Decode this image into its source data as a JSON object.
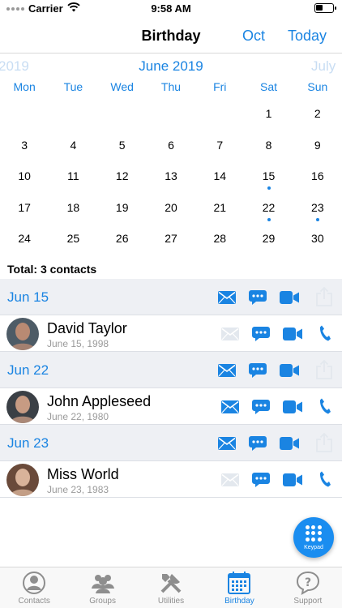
{
  "status": {
    "carrier": "Carrier",
    "time": "9:58 AM"
  },
  "nav": {
    "title": "Birthday",
    "oct": "Oct",
    "today": "Today"
  },
  "calendar": {
    "prev_month": "2019",
    "month": "June 2019",
    "next_month": "July",
    "weekdays": [
      "Mon",
      "Tue",
      "Wed",
      "Thu",
      "Fri",
      "Sat",
      "Sun"
    ],
    "weeks": [
      [
        "",
        "",
        "",
        "",
        "",
        "1",
        "2"
      ],
      [
        "3",
        "4",
        "5",
        "6",
        "7",
        "8",
        "9"
      ],
      [
        "10",
        "11",
        "12",
        "13",
        "14",
        "15",
        "16"
      ],
      [
        "17",
        "18",
        "19",
        "20",
        "21",
        "22",
        "23"
      ],
      [
        "24",
        "25",
        "26",
        "27",
        "28",
        "29",
        "30"
      ]
    ],
    "birthday_days": [
      "15",
      "22",
      "23"
    ]
  },
  "total": "Total: 3 contacts",
  "groups": [
    {
      "date": "Jun 15",
      "contact": {
        "name": "David Taylor",
        "birthday": "June 15, 1998",
        "email_enabled": false
      }
    },
    {
      "date": "Jun 22",
      "contact": {
        "name": "John Appleseed",
        "birthday": "June 22, 1980",
        "email_enabled": true
      }
    },
    {
      "date": "Jun 23",
      "contact": {
        "name": "Miss World",
        "birthday": "June 23, 1983",
        "email_enabled": false
      }
    }
  ],
  "fab": {
    "label": "Keypad"
  },
  "tabs": [
    {
      "label": "Contacts",
      "icon": "person-circle-icon",
      "active": false
    },
    {
      "label": "Groups",
      "icon": "group-icon",
      "active": false
    },
    {
      "label": "Utilities",
      "icon": "tools-icon",
      "active": false
    },
    {
      "label": "Birthday",
      "icon": "calendar-icon",
      "active": true
    },
    {
      "label": "Support",
      "icon": "question-bubble-icon",
      "active": false
    }
  ],
  "colors": {
    "accent": "#1a84e2",
    "section_bg": "#eef0f4",
    "disabled": "#e3e8ee"
  }
}
